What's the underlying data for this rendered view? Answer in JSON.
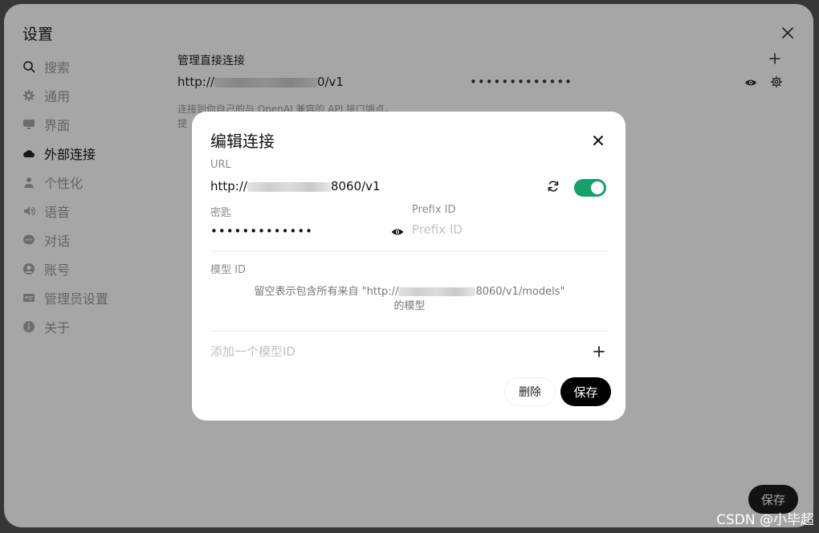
{
  "settings": {
    "title": "设置",
    "sidebar": {
      "items": [
        {
          "label": "搜索",
          "icon": "search-icon"
        },
        {
          "label": "通用",
          "icon": "gear-icon"
        },
        {
          "label": "界面",
          "icon": "monitor-icon"
        },
        {
          "label": "外部连接",
          "icon": "cloud-icon",
          "active": true
        },
        {
          "label": "个性化",
          "icon": "user-icon"
        },
        {
          "label": "语音",
          "icon": "speaker-icon"
        },
        {
          "label": "对话",
          "icon": "chat-icon"
        },
        {
          "label": "账号",
          "icon": "account-icon"
        },
        {
          "label": "管理员设置",
          "icon": "admin-card-icon"
        },
        {
          "label": "关于",
          "icon": "info-icon"
        }
      ]
    },
    "content": {
      "section_title": "管理直接连接",
      "connection": {
        "url_prefix": "http://",
        "url_suffix": "0/v1",
        "key_masked": "•••••••••••••"
      },
      "description_line1": "连接到你自己的与 OpenAI 兼容的 API 接口端点。",
      "description_line2": "提"
    },
    "save_label": "保存"
  },
  "modal": {
    "title": "编辑连接",
    "url_label": "URL",
    "url_prefix": "http://",
    "url_suffix": "8060/v1",
    "toggle_enabled": true,
    "key_label": "密匙",
    "key_masked": "•••••••••••••",
    "prefix_label": "Prefix ID",
    "prefix_placeholder": "Prefix ID",
    "model_label": "模型 ID",
    "model_hint_prefix": "留空表示包含所有来自 \"http://",
    "model_hint_suffix": "8060/v1/models\"",
    "model_hint_line2": "的模型",
    "add_model_placeholder": "添加一个模型ID",
    "delete_label": "删除",
    "save_label": "保存"
  },
  "watermark": "CSDN @小毕超",
  "colors": {
    "toggle_on": "#16a06a",
    "primary_button": "#000000"
  }
}
